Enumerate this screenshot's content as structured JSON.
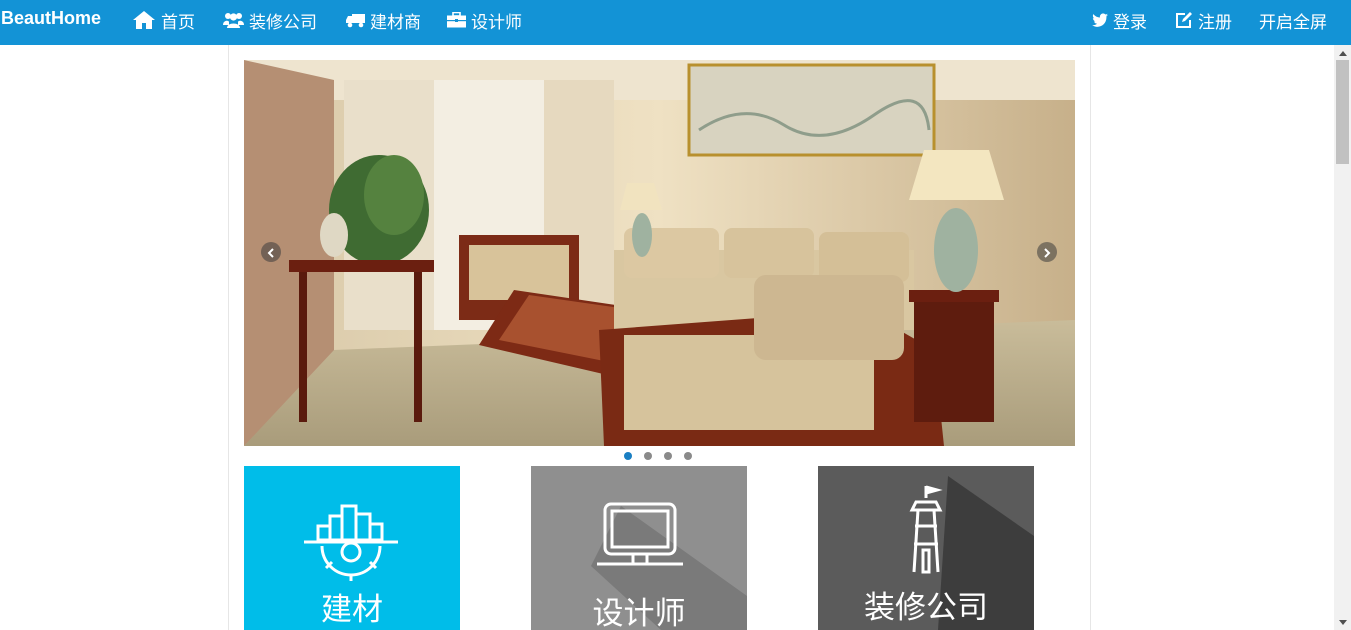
{
  "nav": {
    "brand": "BeautHome",
    "left_items": [
      {
        "label": "首页",
        "icon": "home-icon"
      },
      {
        "label": "装修公司",
        "icon": "users-icon"
      },
      {
        "label": "建材商",
        "icon": "truck-icon"
      },
      {
        "label": "设计师",
        "icon": "briefcase-icon"
      }
    ],
    "right_items": [
      {
        "label": "登录",
        "icon": "twitter-icon"
      },
      {
        "label": "注册",
        "icon": "edit-icon"
      },
      {
        "label": "开启全屏"
      }
    ],
    "color": "#1393d6"
  },
  "carousel": {
    "slide_count": 4,
    "active_index": 0,
    "prev_icon": "chevron-left-icon",
    "next_icon": "chevron-right-icon"
  },
  "tiles": [
    {
      "label": "建材",
      "icon": "city-gear-icon",
      "color": "#00bde9"
    },
    {
      "label": "设计师",
      "icon": "monitor-icon",
      "color": "#8f8f8f"
    },
    {
      "label": "装修公司",
      "icon": "lighthouse-icon",
      "color": "#5b5b5b"
    }
  ]
}
